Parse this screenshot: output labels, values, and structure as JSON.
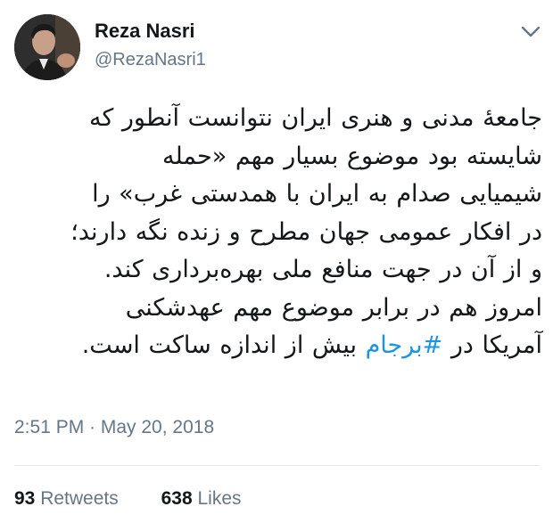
{
  "user": {
    "name": "Reza Nasri",
    "handle": "@RezaNasri1"
  },
  "tweet": {
    "lines": [
      "جامعۀ مدنی و هنری ایران  نتوانست آنطور که",
      "شایسته بود موضوع بسیار مهم «حمله",
      "شیمیایی صدام به ایران با همدستی غرب» را",
      "در افکار عمومی جهان مطرح و زنده نگه دارند؛",
      "و از آن در جهت منافع ملی بهره‌برداری کند.",
      "امروز هم در برابر موضوع مهم عهدشکنی"
    ],
    "last_line_prefix": "آمریکا در ",
    "hashtag": "#برجام",
    "last_line_suffix": " بیش از اندازه ساکت است."
  },
  "timestamp": "2:51 PM · May 20, 2018",
  "stats": {
    "retweets_count": "93",
    "retweets_label": "Retweets",
    "likes_count": "638",
    "likes_label": "Likes"
  },
  "icons": {
    "menu": "chevron-down-icon"
  },
  "colors": {
    "link": "#1b95e0",
    "secondary": "#657786",
    "divider": "#e1e8ed"
  }
}
